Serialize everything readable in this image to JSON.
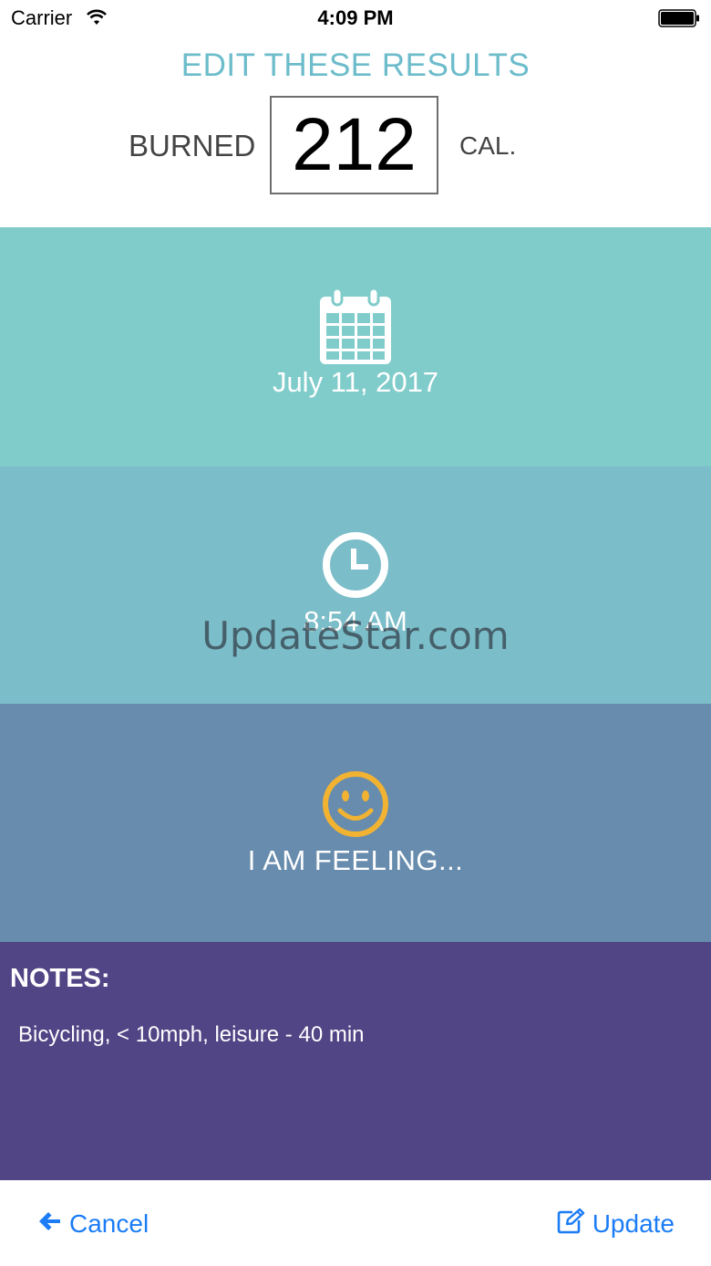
{
  "status_bar": {
    "carrier": "Carrier",
    "time": "4:09 PM",
    "icons": [
      "wifi-icon",
      "battery-icon"
    ]
  },
  "header": {
    "title": "EDIT THESE RESULTS",
    "burned_label": "BURNED",
    "calories": "212",
    "unit_label": "CAL."
  },
  "date_panel": {
    "icon": "calendar-icon",
    "value": "July 11, 2017"
  },
  "time_panel": {
    "icon": "clock-icon",
    "value": "8:54 AM"
  },
  "mood_panel": {
    "icon": "smiley-icon",
    "label": "I AM FEELING..."
  },
  "notes": {
    "label": "NOTES:",
    "value": "Bicycling, < 10mph, leisure - 40 min"
  },
  "watermark": "UpdateStar.com",
  "footer": {
    "cancel_label": "Cancel",
    "cancel_icon": "arrow-left-icon",
    "update_label": "Update",
    "update_icon": "edit-icon"
  },
  "colors": {
    "title": "#6cbccb",
    "date_panel": "#80cccb",
    "time_panel": "#7bbdc8",
    "mood_panel": "#688cad",
    "notes_panel": "#514585",
    "smiley": "#f2b232",
    "action_blue": "#1b7cf6"
  }
}
